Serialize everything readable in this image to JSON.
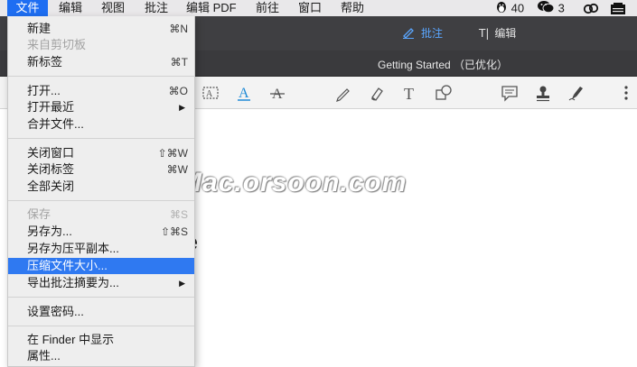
{
  "menubar": {
    "items": [
      "文件",
      "编辑",
      "视图",
      "批注",
      "编辑 PDF",
      "前往",
      "窗口",
      "帮助"
    ],
    "qq_count": "40",
    "wechat_count": "3",
    "accent_color": "#1e6ef2"
  },
  "titlebar": {
    "tab_annotate": "批注",
    "tab_edit": "编辑",
    "doc_title": "Getting Started （已优化）",
    "active_tab_color": "#5aa6ff"
  },
  "document": {
    "heading_fragment": "e",
    "watermark": "Mac.orsoon.com"
  },
  "file_menu": {
    "items": [
      {
        "label": "新建",
        "shortcut": "⌘N"
      },
      {
        "label": "来自剪切板",
        "shortcut": "",
        "disabled": true
      },
      {
        "label": "新标签",
        "shortcut": "⌘T"
      },
      {
        "label": "打开...",
        "shortcut": "⌘O"
      },
      {
        "label": "打开最近",
        "submenu": true
      },
      {
        "label": "合并文件..."
      },
      {
        "label": "关闭窗口",
        "shortcut": "⇧⌘W"
      },
      {
        "label": "关闭标签",
        "shortcut": "⌘W"
      },
      {
        "label": "全部关闭"
      },
      {
        "label": "保存",
        "shortcut": "⌘S",
        "disabled": true
      },
      {
        "label": "另存为...",
        "shortcut": "⇧⌘S"
      },
      {
        "label": "另存为压平副本..."
      },
      {
        "label": "压缩文件大小...",
        "selected": true
      },
      {
        "label": "导出批注摘要为...",
        "submenu": true
      },
      {
        "label": "设置密码..."
      },
      {
        "label": "在 Finder 中显示"
      },
      {
        "label": "属性..."
      }
    ]
  }
}
